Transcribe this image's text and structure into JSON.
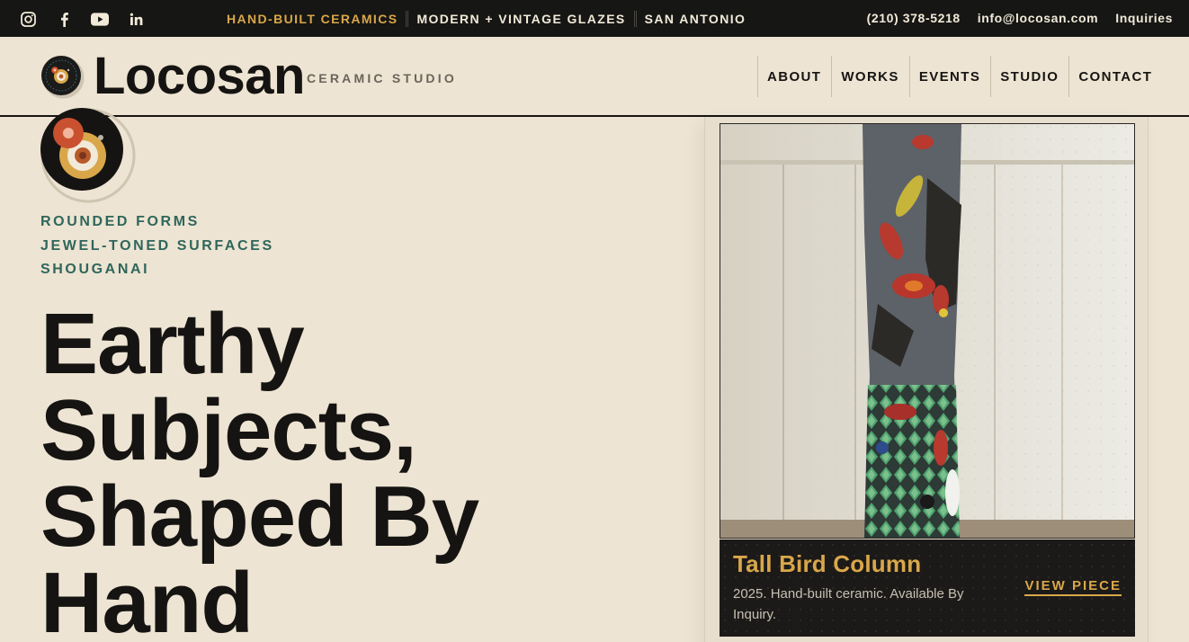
{
  "topbar": {
    "social": [
      {
        "icon": "instagram-icon"
      },
      {
        "icon": "facebook-icon"
      },
      {
        "icon": "youtube-icon"
      },
      {
        "icon": "linkedin-icon"
      }
    ],
    "tags": [
      "HAND-BUILT CERAMICS",
      "MODERN + VINTAGE GLAZES",
      "SAN ANTONIO"
    ],
    "phone": "(210) 378-5218",
    "email": "info@locosan.com",
    "inquiries": "Inquiries"
  },
  "header": {
    "brand": "Locosan",
    "subtitle": "CERAMIC STUDIO",
    "nav": [
      "ABOUT",
      "WORKS",
      "EVENTS",
      "STUDIO",
      "CONTACT"
    ]
  },
  "hero": {
    "taglines": [
      "ROUNDED FORMS",
      "JEWEL-TONED SURFACES",
      "SHOUGANAI"
    ],
    "headline": [
      "Earthy",
      "Subjects,",
      "Shaped By",
      "Hand"
    ]
  },
  "featured": {
    "title": "Tall Bird Column",
    "description": "2025. Hand-built ceramic. Available By Inquiry.",
    "link": "VIEW PIECE"
  },
  "colors": {
    "background": "#ede4d3",
    "dark": "#161614",
    "accent": "#d9a74a",
    "tagline": "#2f665b"
  }
}
